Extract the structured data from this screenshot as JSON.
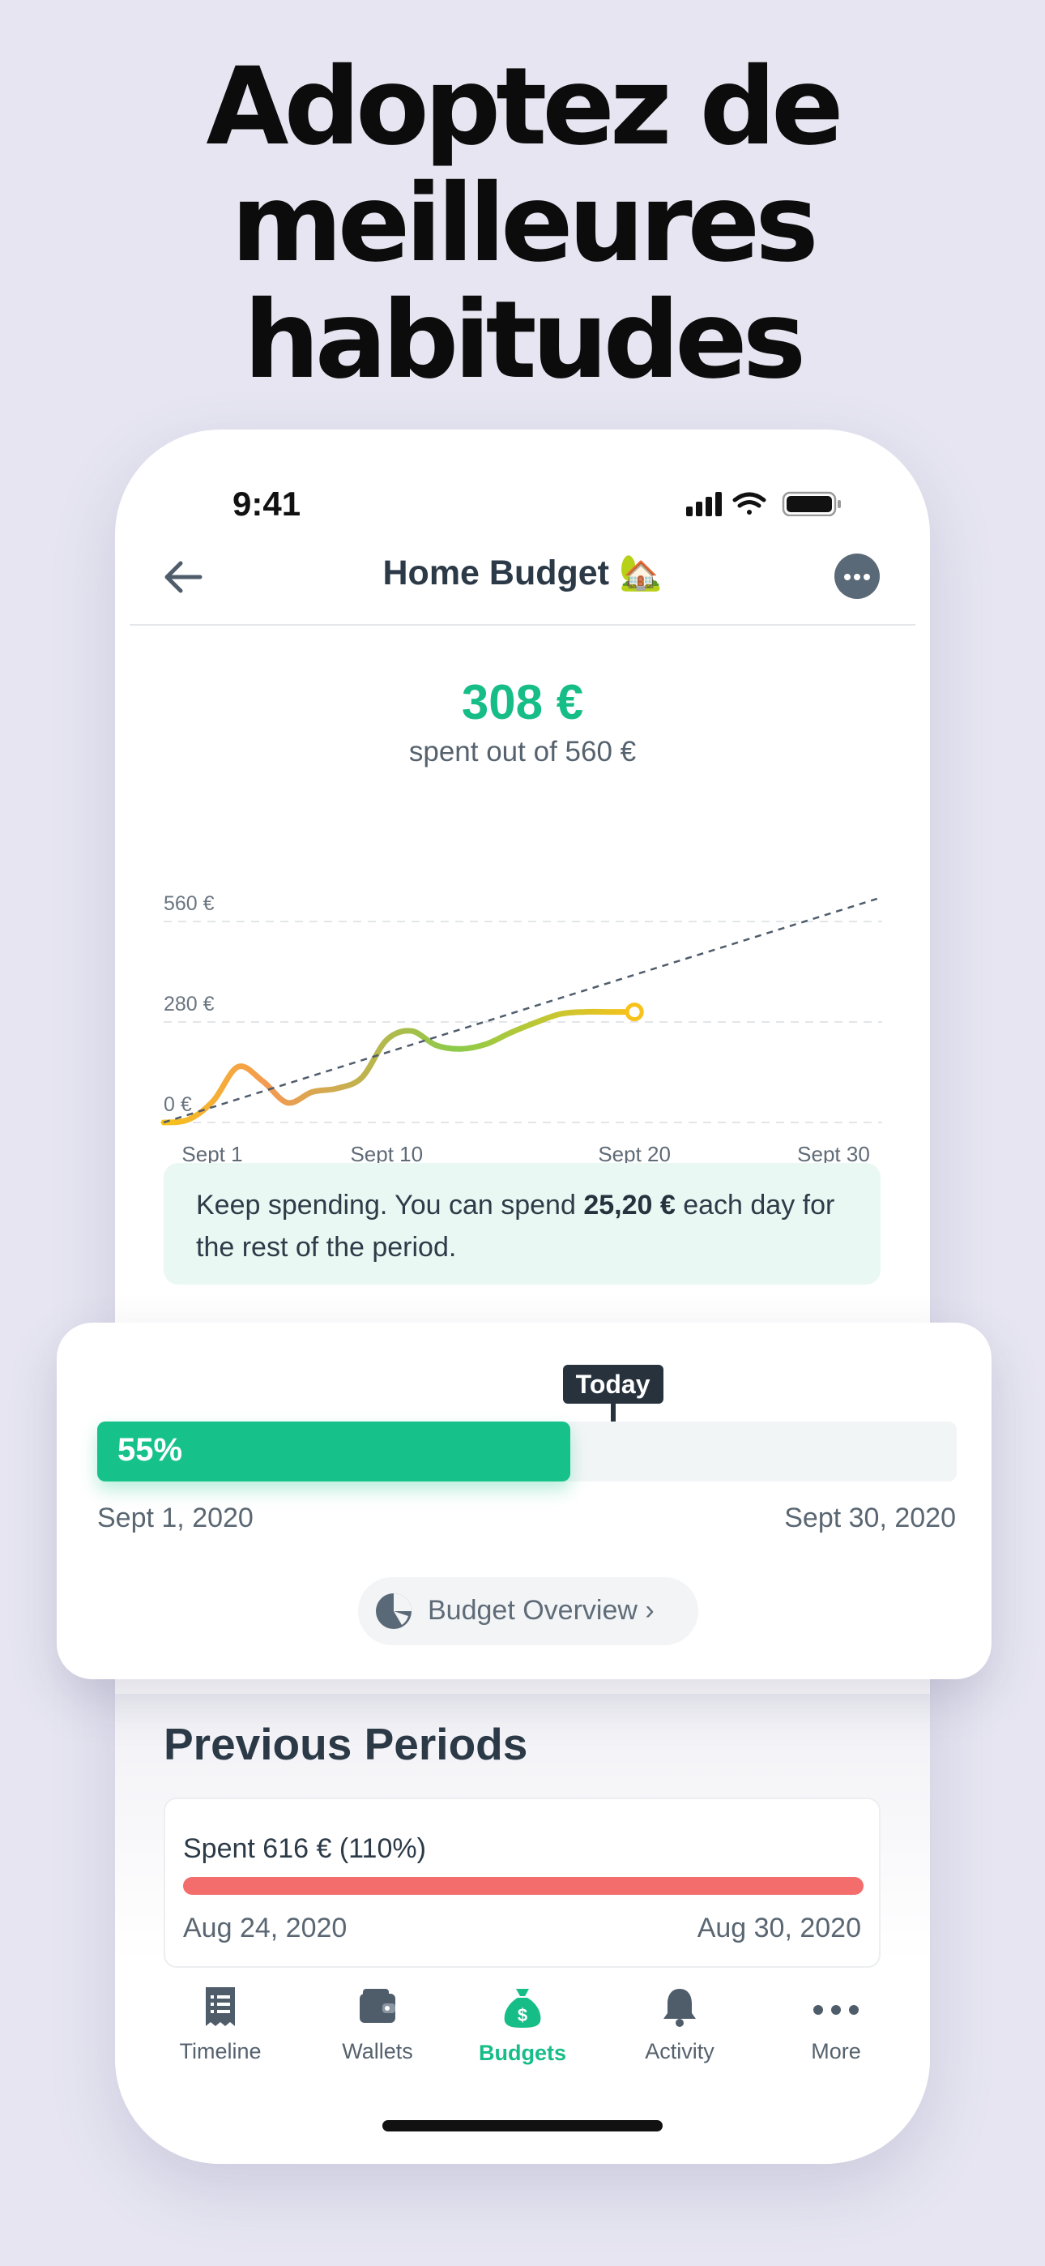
{
  "headline": [
    "Adoptez de",
    "meilleures",
    "habitudes"
  ],
  "status_bar": {
    "time": "9:41"
  },
  "nav": {
    "title": "Home Budget 🏡"
  },
  "summary": {
    "amount": "308 €",
    "subtitle": "spent out of 560 €"
  },
  "chart_data": {
    "type": "line",
    "x_ticks": [
      "Sept 1",
      "Sept 10",
      "Sept 20",
      "Sept 30"
    ],
    "y_ticks": [
      "560 €",
      "280 €",
      "0 €"
    ],
    "ylim": [
      0,
      560
    ],
    "xlim": [
      1,
      30
    ],
    "series": [
      {
        "kind": "actual",
        "x": [
          1,
          2,
          3,
          4,
          5,
          6,
          7,
          8,
          9,
          10,
          11,
          12,
          13,
          14,
          15,
          16,
          17,
          18,
          19,
          20
        ],
        "y": [
          0,
          8,
          60,
          155,
          115,
          55,
          85,
          95,
          125,
          230,
          255,
          215,
          205,
          218,
          250,
          278,
          302,
          308,
          308,
          308
        ]
      },
      {
        "kind": "target",
        "x": [
          1,
          30
        ],
        "y": [
          0,
          560
        ]
      }
    ],
    "current_point": {
      "x": 20,
      "y": 308
    },
    "gradient_colors": [
      "#f7c21b",
      "#f49a52",
      "#8ccb4a",
      "#f7c21b"
    ],
    "grid": true
  },
  "advice": {
    "prefix": "Keep spending. You can spend ",
    "amount": "25,20 €",
    "suffix": " each day for the rest of the period."
  },
  "progress": {
    "today_label": "Today",
    "percent_label": "55%",
    "fraction": 0.55,
    "today_fraction": 0.6,
    "start_date": "Sept 1, 2020",
    "end_date": "Sept 30, 2020",
    "overview_label": "Budget Overview ›"
  },
  "previous_periods": {
    "title": "Previous Periods",
    "items": [
      {
        "spent": "Spent 616 € (110%)",
        "start": "Aug 24, 2020",
        "end": "Aug 30, 2020"
      }
    ]
  },
  "tabs": [
    {
      "label": "Timeline",
      "icon": "receipt-icon"
    },
    {
      "label": "Wallets",
      "icon": "wallet-icon"
    },
    {
      "label": "Budgets",
      "icon": "money-bag-icon",
      "active": true
    },
    {
      "label": "Activity",
      "icon": "bell-icon"
    },
    {
      "label": "More",
      "icon": "dots-icon"
    }
  ],
  "colors": {
    "accent": "#17bd87",
    "danger": "#f46d6d",
    "text_dark": "#2c3a47",
    "background": "#e6e5f1"
  }
}
